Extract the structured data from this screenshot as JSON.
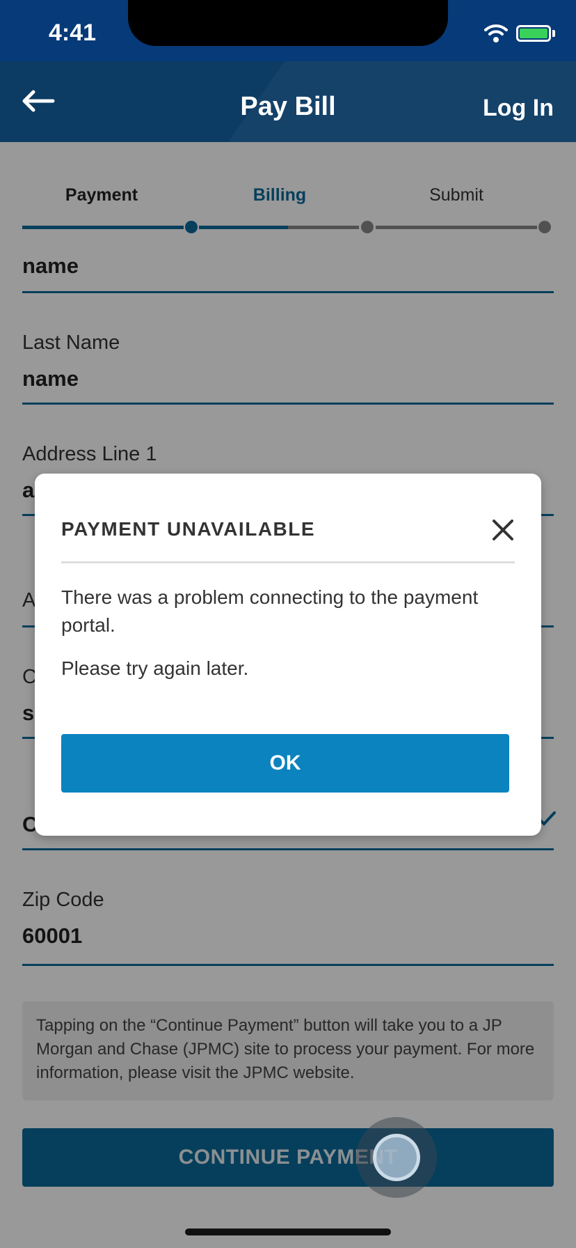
{
  "status_bar": {
    "time": "4:41"
  },
  "nav": {
    "title": "Pay Bill",
    "login": "Log In"
  },
  "stepper": {
    "steps": [
      {
        "label": "Payment"
      },
      {
        "label": "Billing"
      },
      {
        "label": "Submit"
      }
    ]
  },
  "form": {
    "first_name_value": "name",
    "last_name_label": "Last Name",
    "last_name_value": "name",
    "address1_label": "Address Line 1",
    "address1_value": "a",
    "address2_label": "A",
    "city_label": "C",
    "city_value": "s",
    "state_value": "C",
    "zip_label": "Zip Code",
    "zip_value": "60001",
    "notice": "Tapping on the “Continue Payment” button will take you to a JP Morgan and Chase (JPMC) site to process your payment. For more information, please visit the JPMC website.",
    "continue_label": "CONTINUE PAYMENT"
  },
  "modal": {
    "title": "PAYMENT UNAVAILABLE",
    "message": "There was a problem connecting to the payment portal.",
    "message2": "Please try again later.",
    "ok_label": "OK"
  },
  "colors": {
    "status_bar": "#073a78",
    "nav_bar": "#0c3b63",
    "accent": "#0a6a99",
    "ok_button": "#0b83be"
  },
  "icons": [
    "back-arrow-icon",
    "wifi-icon",
    "battery-icon",
    "close-icon",
    "checkmark-icon"
  ]
}
